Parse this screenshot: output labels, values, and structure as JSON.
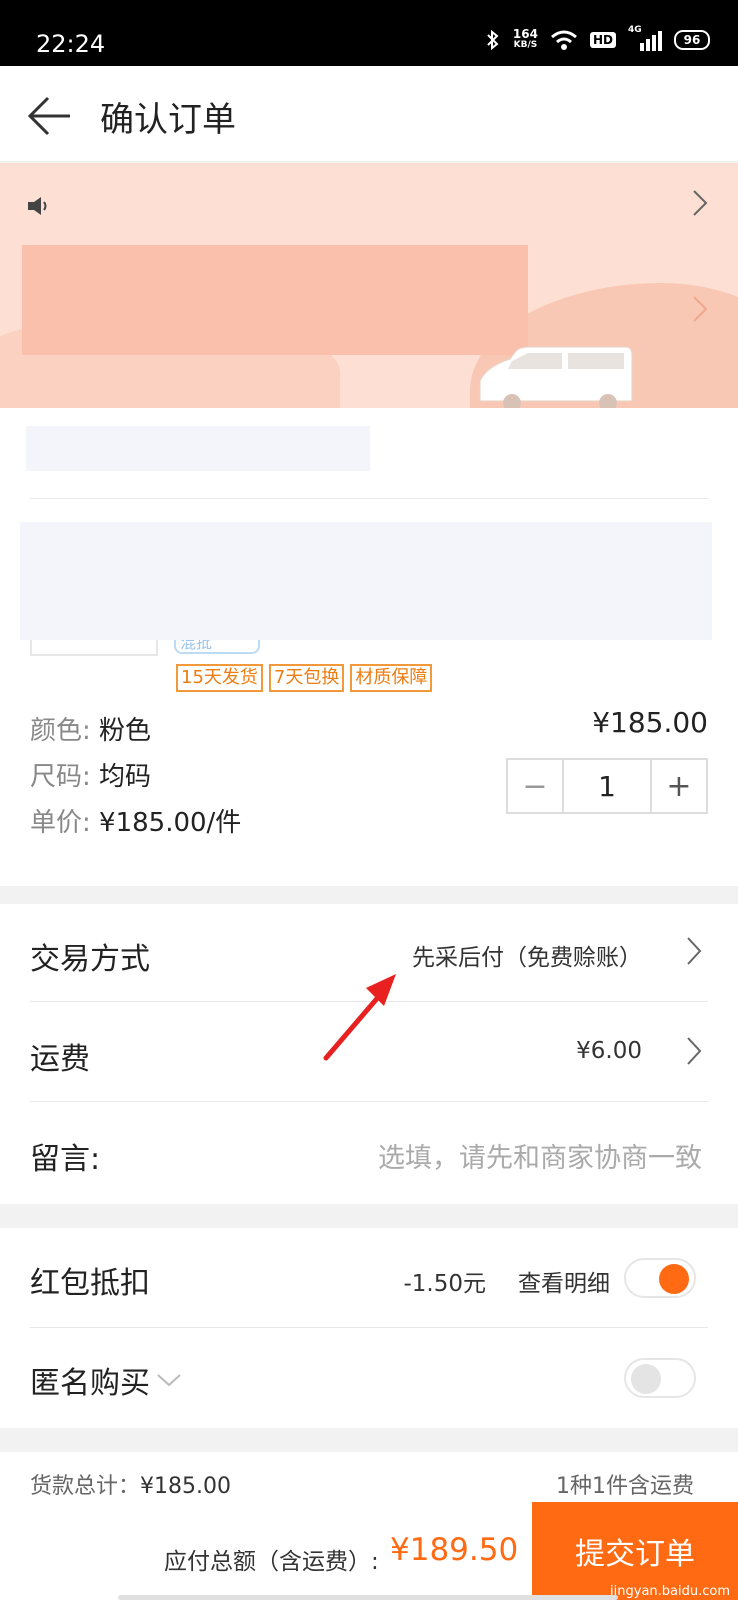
{
  "status_bar": {
    "time": "22:24",
    "speed_value": "164",
    "speed_unit": "KB/S",
    "hd": "HD",
    "network": "4G",
    "battery": "96"
  },
  "header": {
    "title": "确认订单"
  },
  "product": {
    "tag_peek": "混批",
    "tags": [
      "15天发货",
      "7天包换",
      "材质保障"
    ],
    "color_label": "颜色:",
    "color_value": "粉色",
    "size_label": "尺码:",
    "size_value": "均码",
    "unit_price_label": "单价:",
    "unit_price_value": "¥185.00/件",
    "price": "¥185.00",
    "quantity": "1",
    "minus": "−",
    "plus": "+"
  },
  "order": {
    "trade_label": "交易方式",
    "trade_value": "先采后付（免费赊账）",
    "shipping_label": "运费",
    "shipping_value": "¥6.00",
    "message_label": "留言:",
    "message_placeholder": "选填，请先和商家协商一致"
  },
  "options": {
    "red_packet_label": "红包抵扣",
    "red_packet_value": "-1.50元",
    "red_packet_detail": "查看明细",
    "red_packet_on": true,
    "anonymous_label": "匿名购买",
    "anonymous_on": false
  },
  "footer": {
    "goods_total_label": "货款总计：",
    "goods_total_value": "¥185.00",
    "count_info": "1种1件含运费",
    "payable_label": "应付总额（含运费）:",
    "payable_value": "¥189.50",
    "submit_label": "提交订单",
    "watermark": "jingyan.baidu.com"
  },
  "colors": {
    "accent": "#ff6a13",
    "tag": "#ee7d12",
    "banner": "#fde0d3",
    "annotation_arrow": "#e8201f"
  }
}
